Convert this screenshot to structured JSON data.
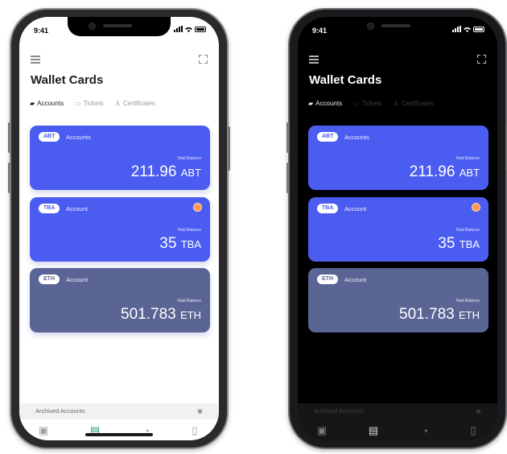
{
  "status": {
    "time": "9:41"
  },
  "header": {
    "title": "Wallet Cards"
  },
  "tabs": [
    {
      "label": "Accounts",
      "icon": "wallet-icon",
      "active": true
    },
    {
      "label": "Tickets",
      "icon": "ticket-icon",
      "active": false
    },
    {
      "label": "Certificates",
      "icon": "certificate-icon",
      "active": false
    }
  ],
  "cards": [
    {
      "badge": "ABT",
      "type": "Accounts",
      "balance_label": "Total Balance",
      "amount": "211.96",
      "currency": "ABT",
      "color": "#4b5cf0",
      "badge_text_color": "#4b5cf0"
    },
    {
      "badge": "TBA",
      "type": "Account",
      "balance_label": "Total Balance",
      "amount": "35",
      "currency": "TBA",
      "color": "#4b5cf0",
      "badge_text_color": "#4b5cf0"
    },
    {
      "badge": "ETH",
      "type": "Account",
      "balance_label": "Total Balance",
      "amount": "501.783",
      "currency": "ETH",
      "color": "#5b6595",
      "badge_text_color": "#5b6595"
    }
  ],
  "archived": {
    "label": "Archived Accounts"
  },
  "tabbar": [
    {
      "icon": "id-card-icon",
      "active": false
    },
    {
      "icon": "wallet-icon",
      "active": true
    },
    {
      "icon": "planet-icon",
      "active": false
    },
    {
      "icon": "document-icon",
      "active": false
    }
  ],
  "colors": {
    "accent_card": "#4b5cf0",
    "eth_card": "#5b6595",
    "active_tab_green": "#1d9a80"
  }
}
